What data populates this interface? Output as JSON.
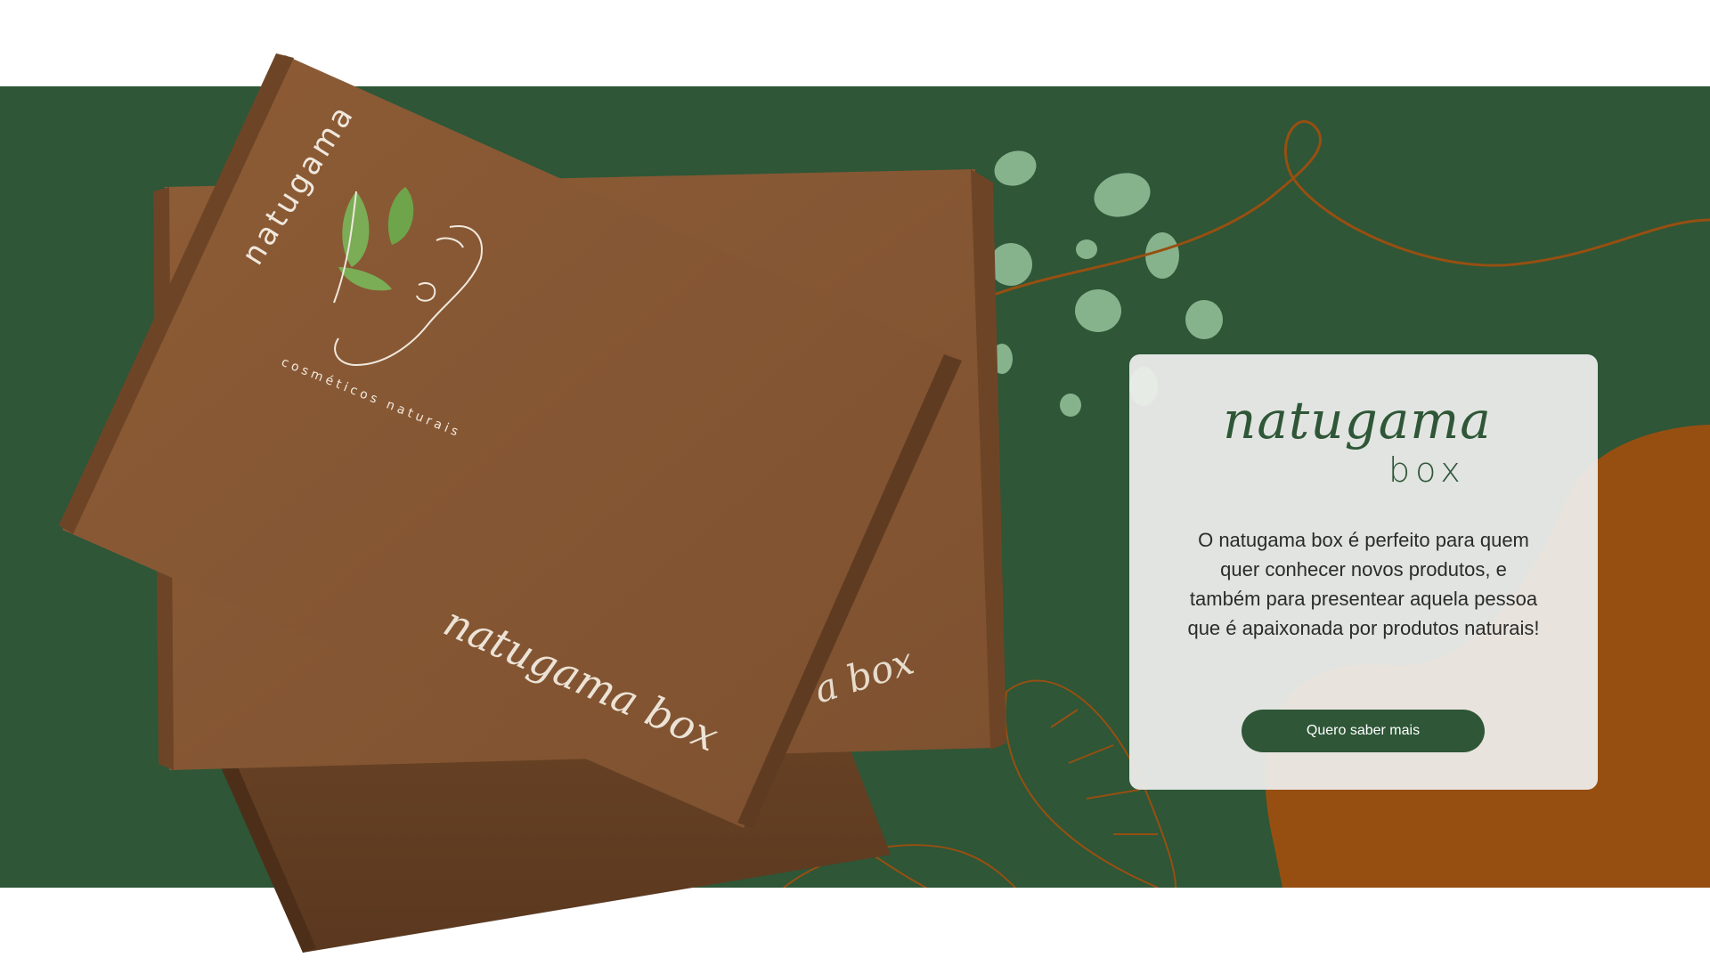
{
  "colors": {
    "banner_green": "#2e5637",
    "rust_orange": "#974f11",
    "kraft_brown": "#8a5a35",
    "leaf_light_green": "#86b38c",
    "card_bg": "#efefed"
  },
  "box_print": {
    "brand_arc": "natugama",
    "tagline_arc": "cosméticos naturais",
    "script_label": "natugama box",
    "back_box_label": "a box"
  },
  "card": {
    "logo_script": "natugama",
    "logo_sub": "box",
    "description": "O natugama box é perfeito para quem quer conhecer novos produtos, e também para presentear aquela pessoa que é apaixonada por produtos naturais!",
    "cta_label": "Quero saber mais"
  },
  "icons": [
    "leaf-logo-icon",
    "face-line-art-icon"
  ]
}
